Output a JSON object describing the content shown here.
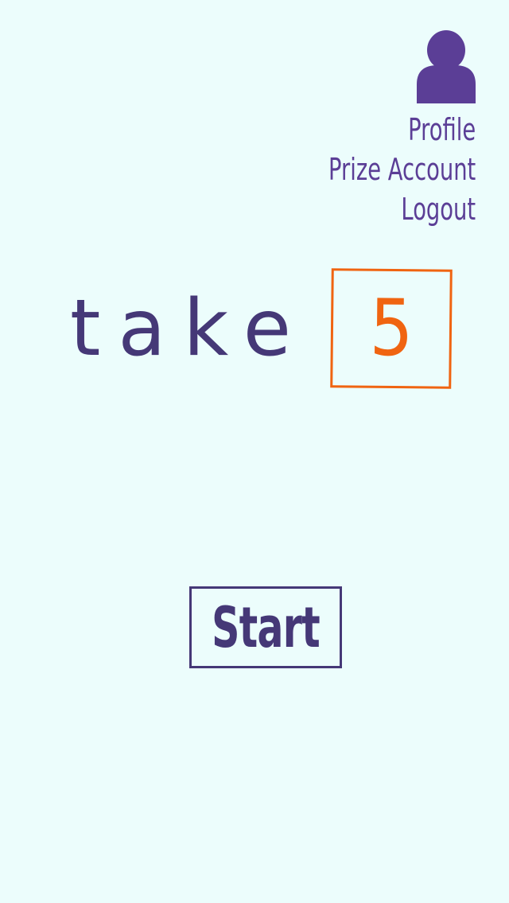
{
  "header": {
    "profile_icon": "user-icon",
    "menu": {
      "profile": "Profile",
      "prize_account": "Prize Account",
      "logout": "Logout"
    }
  },
  "logo": {
    "word": "take",
    "number": "5"
  },
  "main": {
    "start_label": "Start"
  },
  "colors": {
    "background": "#ecfdfc",
    "primary": "#453877",
    "menu": "#5b3e96",
    "accent": "#f06411"
  }
}
